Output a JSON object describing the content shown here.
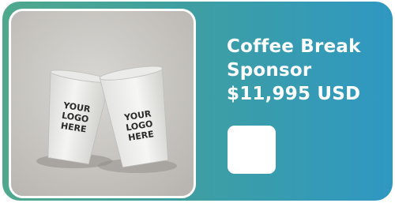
{
  "card": {
    "title_line1": "Coffee Break",
    "title_line2": "Sponsor",
    "price": "$11,995 USD",
    "accent_start": "#4fa88c",
    "accent_end": "#2f98c2"
  },
  "photo": {
    "left_cup_text": [
      "YOUR",
      "LOGO",
      "HERE"
    ],
    "right_cup_text": [
      "YOUR",
      "LOGO",
      "HERE"
    ]
  }
}
